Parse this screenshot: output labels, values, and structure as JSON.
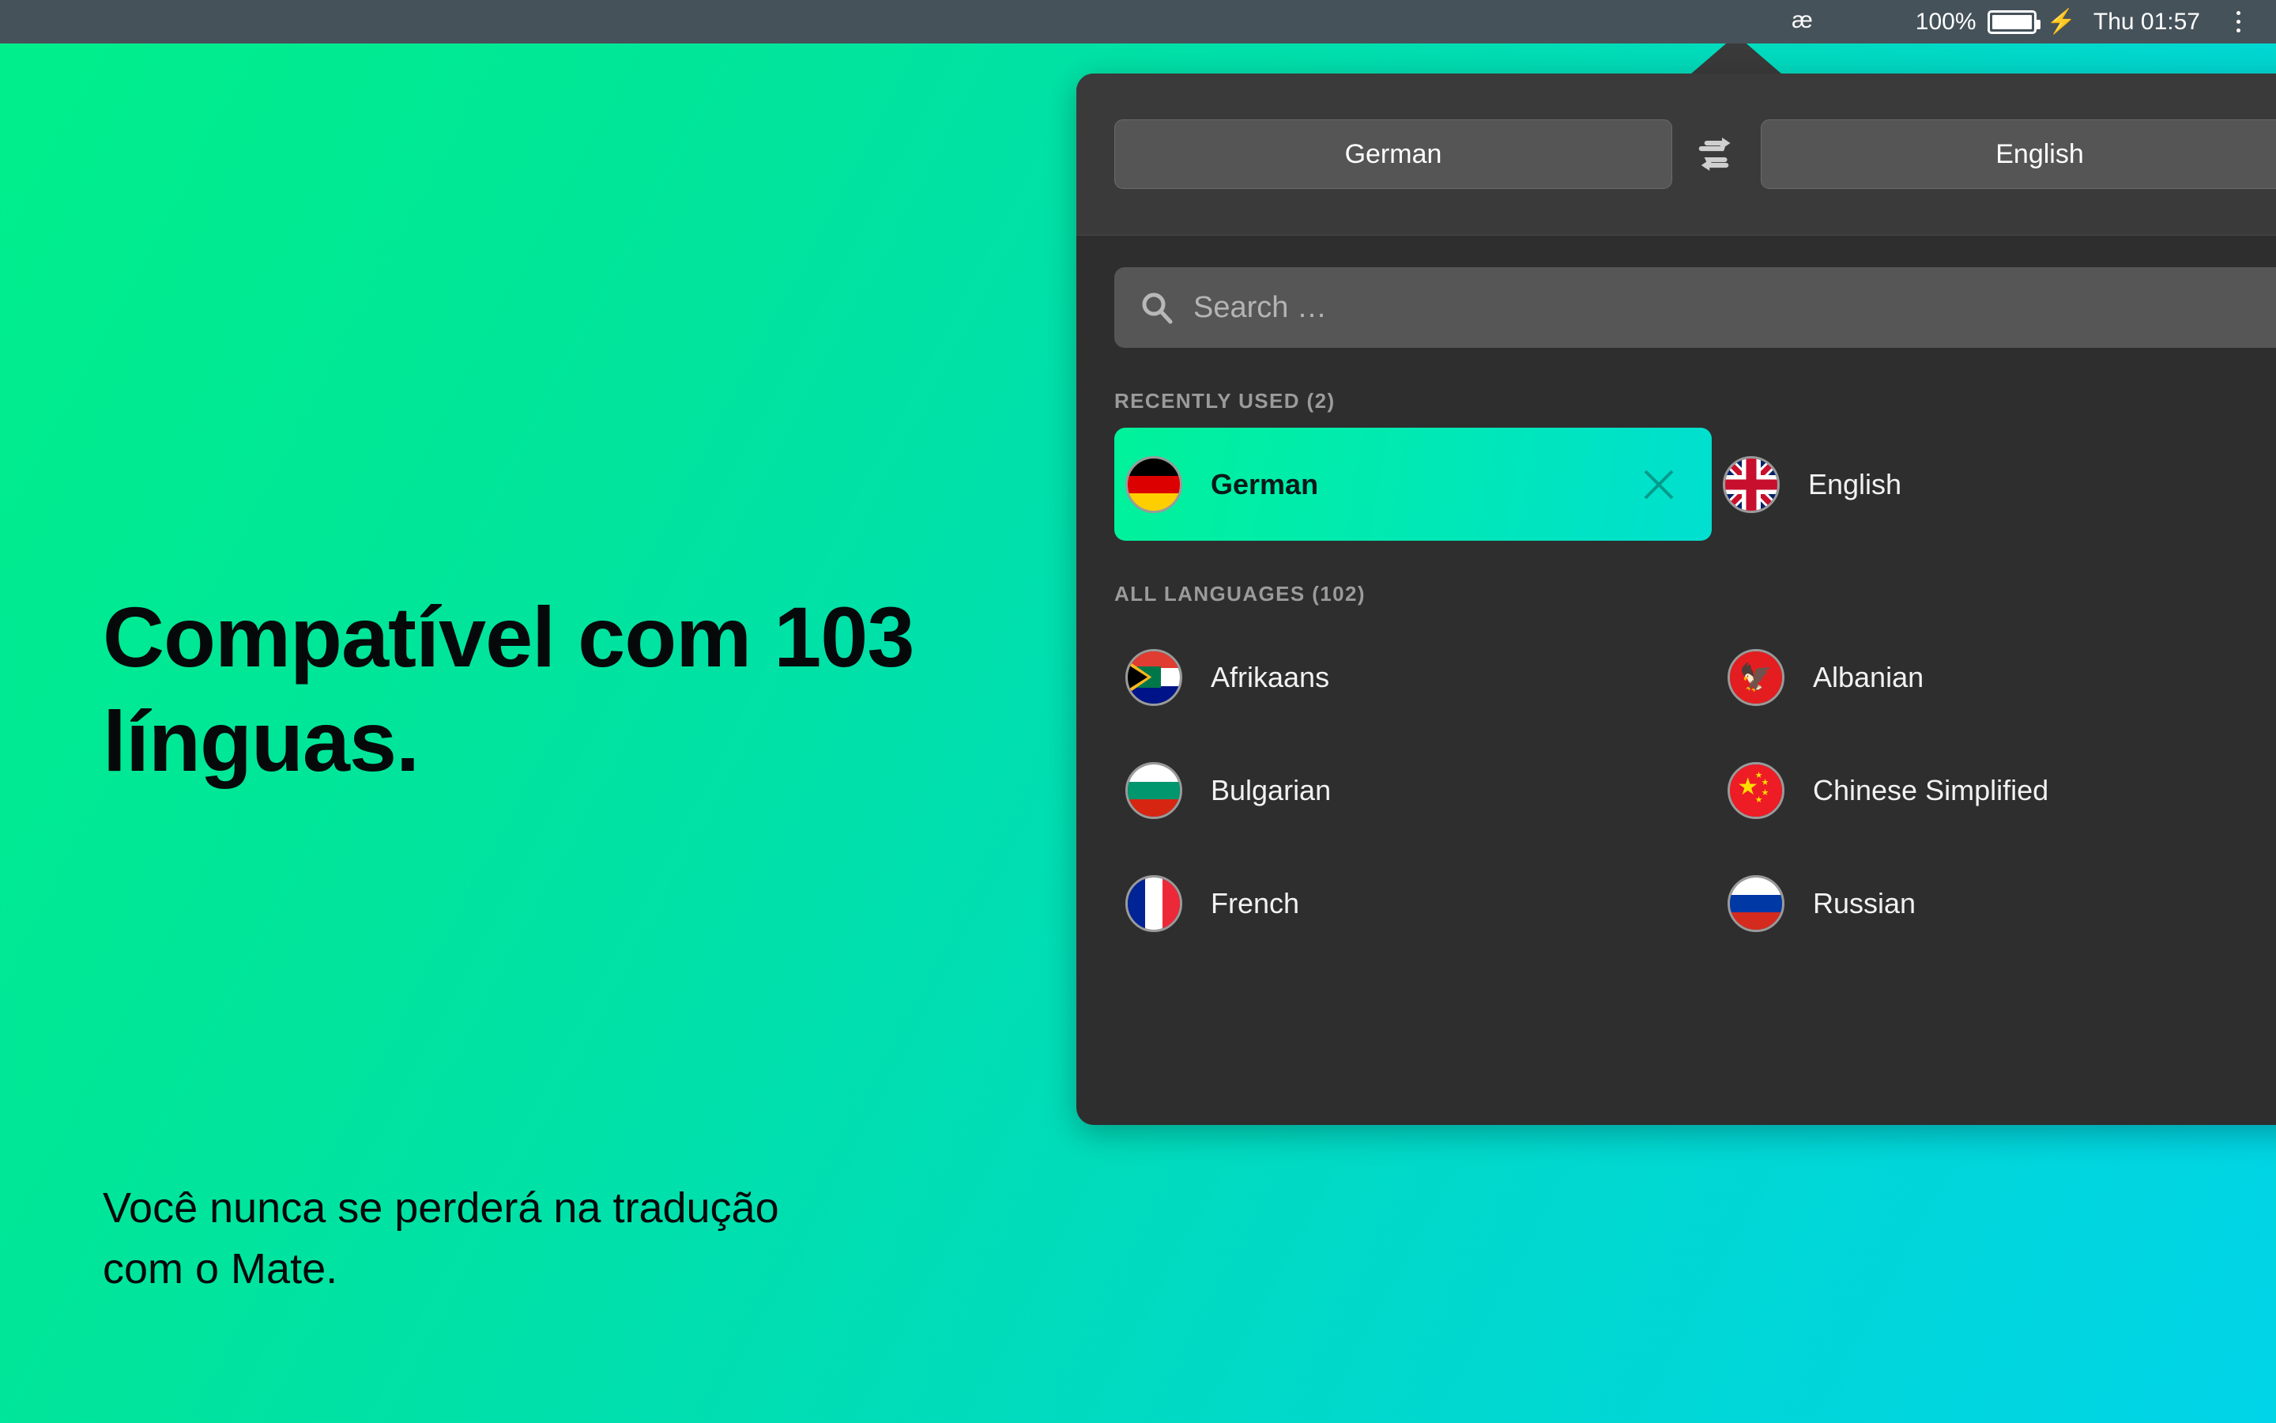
{
  "menubar": {
    "app_glyph": "æ",
    "battery_percent": "100%",
    "charging_icon": "⚡",
    "clock": "Thu 01:57",
    "list_icon": "list-icon"
  },
  "marketing": {
    "headline": "Compatível com 103 línguas.",
    "subheadline": "Você nunca se perderá na tradução com o Mate."
  },
  "popover": {
    "source_language": "German",
    "target_language": "English",
    "swap_icon": "swap-arrows-icon",
    "search": {
      "placeholder": "Search …",
      "value": "",
      "icon": "search-icon"
    },
    "recently_used": {
      "title": "RECENTLY USED (2)",
      "items": [
        {
          "name": "German",
          "flag": "de",
          "selected": true,
          "remove_icon": "close-icon"
        },
        {
          "name": "English",
          "flag": "gb",
          "selected": false
        }
      ]
    },
    "all_languages": {
      "title": "ALL LANGUAGES (102)",
      "items": [
        {
          "name": "Afrikaans",
          "flag": "za"
        },
        {
          "name": "Albanian",
          "flag": "al"
        },
        {
          "name": "Bulgarian",
          "flag": "bg"
        },
        {
          "name": "Chinese Simplified",
          "flag": "cn"
        },
        {
          "name": "French",
          "flag": "fr"
        },
        {
          "name": "Russian",
          "flag": "ru"
        }
      ]
    }
  },
  "colors": {
    "accent_green": "#00f29a",
    "accent_cyan": "#00d4e8",
    "menubar": "#46525a",
    "popover_body": "#2e2e2e",
    "popover_header": "#3a3a3a",
    "field": "#565656"
  }
}
